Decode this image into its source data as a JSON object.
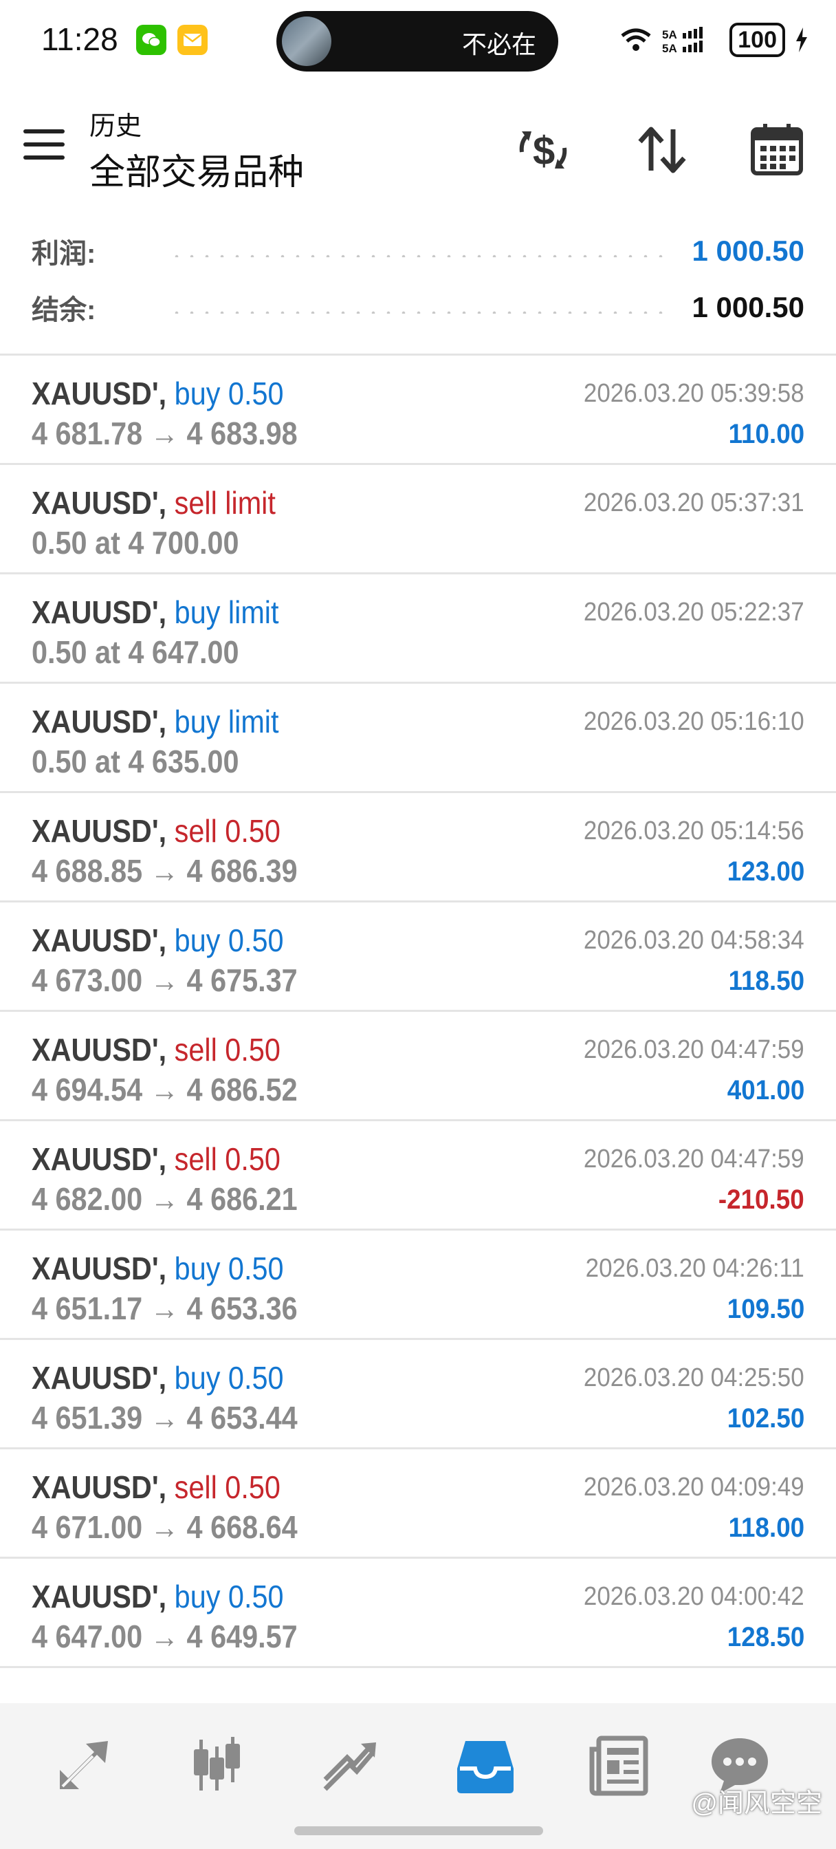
{
  "status_bar": {
    "time": "11:28",
    "island_text": "不必在",
    "network": "5A",
    "battery": "100"
  },
  "header": {
    "subtitle": "历史",
    "title": "全部交易品种"
  },
  "summary": {
    "profit_label": "利润:",
    "profit_value": "1 000.50",
    "balance_label": "结余:",
    "balance_value": "1 000.50"
  },
  "trades": [
    {
      "symbol": "XAUUSD',",
      "side": "buy 0.50",
      "details": "4 681.78 → 4 683.98",
      "time": "2026.03.20 05:39:58",
      "profit": "110.00"
    },
    {
      "symbol": "XAUUSD',",
      "side": "sell limit",
      "details": "0.50 at 4 700.00",
      "time": "2026.03.20 05:37:31",
      "profit": ""
    },
    {
      "symbol": "XAUUSD',",
      "side": "buy limit",
      "details": "0.50 at 4 647.00",
      "time": "2026.03.20 05:22:37",
      "profit": ""
    },
    {
      "symbol": "XAUUSD',",
      "side": "buy limit",
      "details": "0.50 at 4 635.00",
      "time": "2026.03.20 05:16:10",
      "profit": ""
    },
    {
      "symbol": "XAUUSD',",
      "side": "sell 0.50",
      "details": "4 688.85 → 4 686.39",
      "time": "2026.03.20 05:14:56",
      "profit": "123.00"
    },
    {
      "symbol": "XAUUSD',",
      "side": "buy 0.50",
      "details": "4 673.00 → 4 675.37",
      "time": "2026.03.20 04:58:34",
      "profit": "118.50"
    },
    {
      "symbol": "XAUUSD',",
      "side": "sell 0.50",
      "details": "4 694.54 → 4 686.52",
      "time": "2026.03.20 04:47:59",
      "profit": "401.00"
    },
    {
      "symbol": "XAUUSD',",
      "side": "sell 0.50",
      "details": "4 682.00 → 4 686.21",
      "time": "2026.03.20 04:47:59",
      "profit": "-210.50"
    },
    {
      "symbol": "XAUUSD',",
      "side": "buy 0.50",
      "details": "4 651.17 → 4 653.36",
      "time": "2026.03.20 04:26:11",
      "profit": "109.50"
    },
    {
      "symbol": "XAUUSD',",
      "side": "buy 0.50",
      "details": "4 651.39 → 4 653.44",
      "time": "2026.03.20 04:25:50",
      "profit": "102.50"
    },
    {
      "symbol": "XAUUSD',",
      "side": "sell 0.50",
      "details": "4 671.00 → 4 668.64",
      "time": "2026.03.20 04:09:49",
      "profit": "118.00"
    },
    {
      "symbol": "XAUUSD',",
      "side": "buy 0.50",
      "details": "4 647.00 → 4 649.57",
      "time": "2026.03.20 04:00:42",
      "profit": "128.50"
    }
  ],
  "bottom_nav": [
    {
      "icon": "quotes-icon",
      "active": false
    },
    {
      "icon": "chart-icon",
      "active": false
    },
    {
      "icon": "trade-icon",
      "active": false
    },
    {
      "icon": "history-icon",
      "active": true
    },
    {
      "icon": "news-icon",
      "active": false
    },
    {
      "icon": "chat-icon",
      "active": false
    }
  ],
  "watermark": "@闻风空空",
  "colors": {
    "buy": "#1276d1",
    "sell": "#c6262c",
    "profit_positive": "#1276d1",
    "profit_negative": "#c6262c",
    "active_nav": "#1e88d8",
    "inactive_nav": "#8a8a8a"
  }
}
